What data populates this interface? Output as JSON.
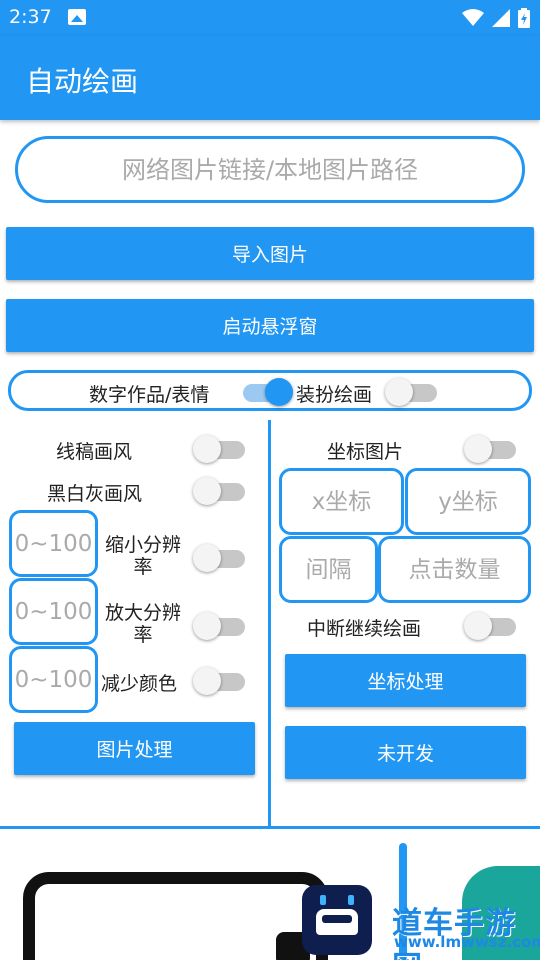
{
  "status_bar": {
    "time": "2:37",
    "icons": [
      "photo-icon",
      "wifi-icon",
      "signal-icon",
      "battery-icon"
    ]
  },
  "app_bar": {
    "title": "自动绘画"
  },
  "source_input": {
    "placeholder": "网络图片链接/本地图片路径",
    "value": ""
  },
  "buttons": {
    "import_image": "导入图片",
    "start_float": "启动悬浮窗"
  },
  "mode": {
    "left_label": "数字作品/表情",
    "right_label": "装扮绘画",
    "mode_switch_on": true,
    "extra_switch_on": false
  },
  "left_panel": {
    "line_style": {
      "label": "线稿画风",
      "on": false
    },
    "bw_style": {
      "label": "黑白灰画风",
      "on": false
    },
    "shrink": {
      "placeholder": "0~100",
      "label": "缩小分辨率",
      "on": false
    },
    "enlarge": {
      "placeholder": "0~100",
      "label": "放大分辨率",
      "on": false
    },
    "reduce_color": {
      "placeholder": "0~100",
      "label": "减少颜色",
      "on": false
    },
    "process_button": "图片处理"
  },
  "right_panel": {
    "coord_image": {
      "label": "坐标图片",
      "on": false
    },
    "x_placeholder": "x坐标",
    "y_placeholder": "y坐标",
    "interval_placeholder": "间隔",
    "click_count_placeholder": "点击数量",
    "resume": {
      "label": "中断继续绘画",
      "on": false
    },
    "coord_button": "坐标处理",
    "undev_button": "未开发"
  },
  "watermark": {
    "text": "道车手游网",
    "url": "www.lmwwsz.com"
  },
  "colors": {
    "primary": "#2196F3",
    "switch_off_track": "#c7c7c7",
    "switch_on_track": "#9cc9f2"
  }
}
